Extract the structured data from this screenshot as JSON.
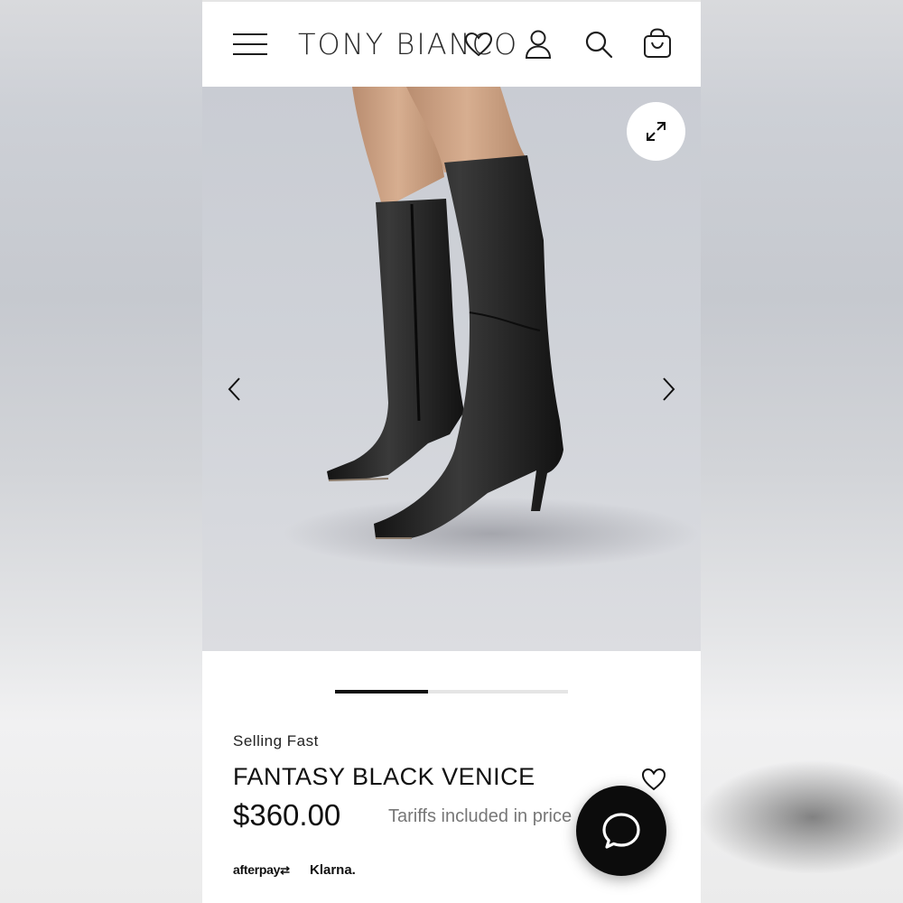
{
  "header": {
    "brand": "TONY BIANCO",
    "icons": [
      "menu-icon",
      "heart-icon",
      "account-icon",
      "search-icon",
      "bag-icon"
    ]
  },
  "gallery": {
    "image": "black-knee-high-boots-photo",
    "current_slide_fraction": 0.4,
    "icons": [
      "expand-icon",
      "chevron-left-icon",
      "chevron-right-icon"
    ]
  },
  "product": {
    "badge": "Selling Fast",
    "name": "FANTASY BLACK VENICE",
    "price": "$360.00",
    "tariff_note": "Tariffs included in price"
  },
  "payments": {
    "afterpay": "afterpay",
    "klarna": "Klarna."
  },
  "colors": {
    "text": "#111111",
    "muted": "#777777",
    "chat_button": "#0c0c0c",
    "pager_active": "#111111",
    "pager_track": "#e5e5e5"
  }
}
